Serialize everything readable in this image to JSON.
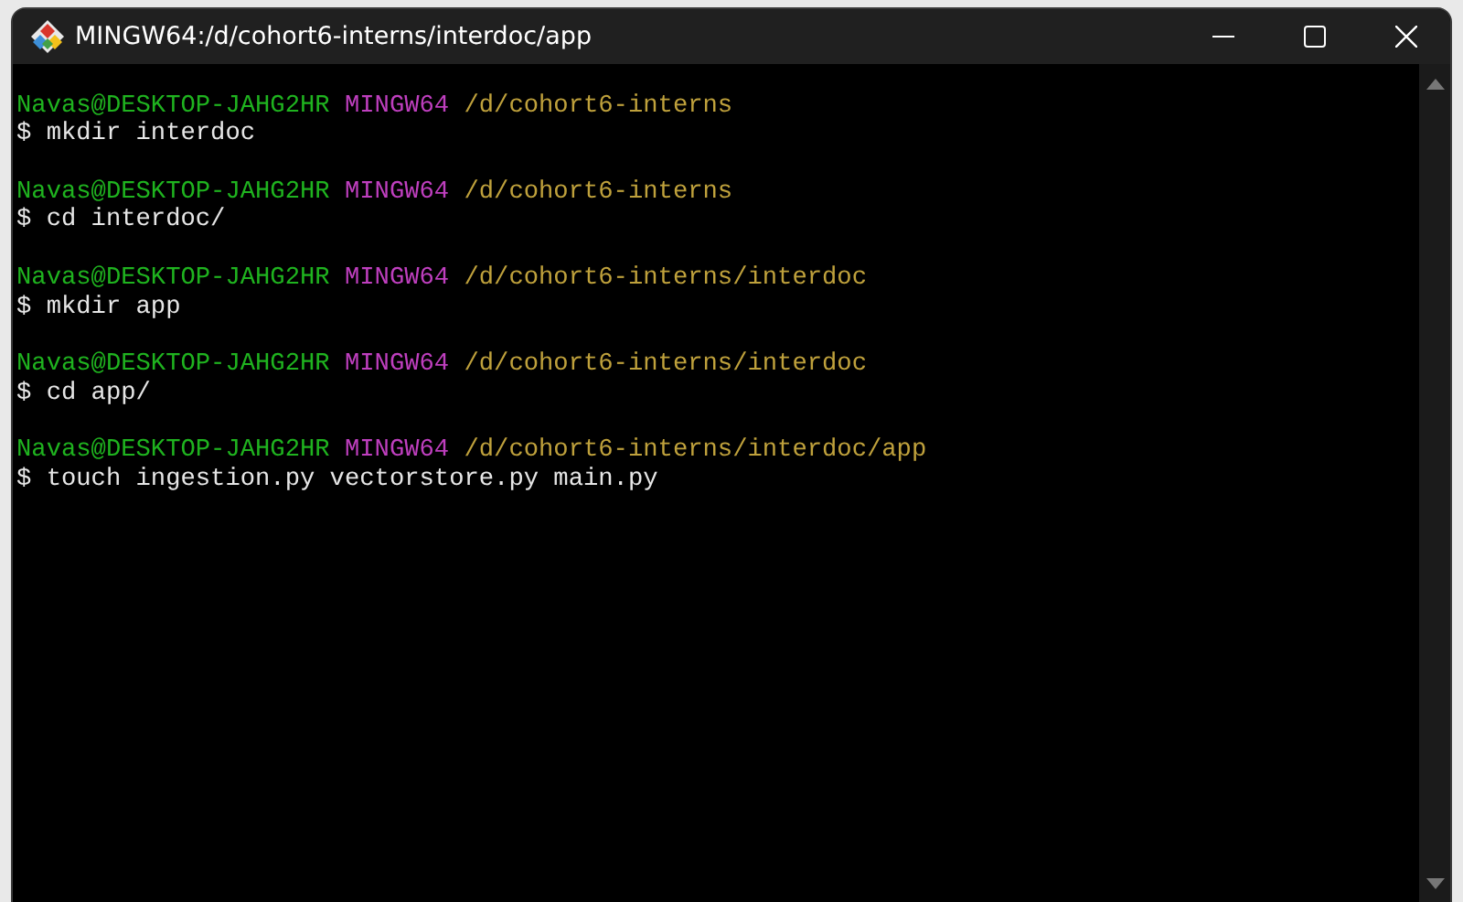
{
  "window": {
    "title": "MINGW64:/d/cohort6-interns/interdoc/app"
  },
  "terminal": {
    "entries": [
      {
        "user_host": "Navas@DESKTOP-JAHG2HR",
        "system": "MINGW64",
        "path": "/d/cohort6-interns",
        "command": "$ mkdir interdoc"
      },
      {
        "user_host": "Navas@DESKTOP-JAHG2HR",
        "system": "MINGW64",
        "path": "/d/cohort6-interns",
        "command": "$ cd interdoc/"
      },
      {
        "user_host": "Navas@DESKTOP-JAHG2HR",
        "system": "MINGW64",
        "path": "/d/cohort6-interns/interdoc",
        "command": "$ mkdir app"
      },
      {
        "user_host": "Navas@DESKTOP-JAHG2HR",
        "system": "MINGW64",
        "path": "/d/cohort6-interns/interdoc",
        "command": "$ cd app/"
      },
      {
        "user_host": "Navas@DESKTOP-JAHG2HR",
        "system": "MINGW64",
        "path": "/d/cohort6-interns/interdoc/app",
        "command": "$ touch ingestion.py vectorstore.py main.py"
      }
    ]
  }
}
